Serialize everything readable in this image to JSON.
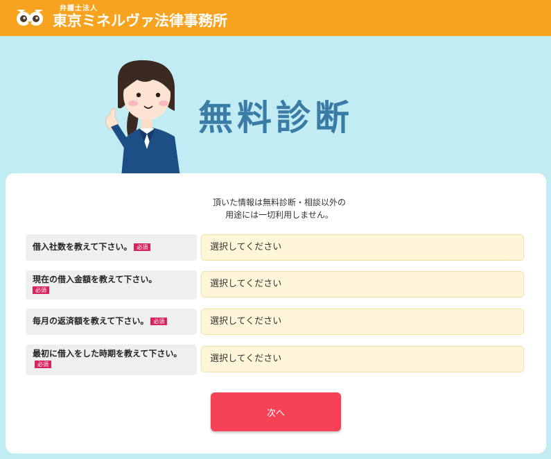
{
  "header": {
    "subtitle": "弁護士法人",
    "firm_name": "東京ミネルヴァ法律事務所",
    "logo_icon": "owl-icon"
  },
  "hero": {
    "title": "無料診断",
    "illustration": "woman-pointing-illustration"
  },
  "form": {
    "notice_line1": "頂いた情報は無料診断・相談以外の",
    "notice_line2": "用途には一切利用しません。",
    "required_badge": "必須",
    "questions": [
      {
        "label": "借入社数を教えて下さい。",
        "placeholder": "選択してください"
      },
      {
        "label": "現在の借入金額を教えて下さい。",
        "placeholder": "選択してください"
      },
      {
        "label": "毎月の返済額を教えて下さい。",
        "placeholder": "選択してください"
      },
      {
        "label": "最初に借入をした時期を教えて下さい。",
        "placeholder": "選択してください"
      }
    ],
    "next_button": "次へ"
  },
  "colors": {
    "header_bg": "#f8a320",
    "page_bg": "#c2ecf3",
    "title": "#3b7ca7",
    "button": "#f64257",
    "required": "#d8235f",
    "select_bg": "#fff5d8"
  }
}
